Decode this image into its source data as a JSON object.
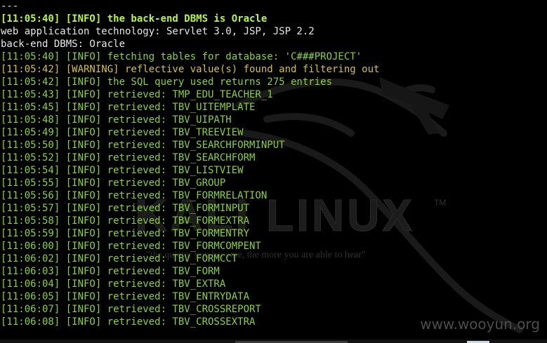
{
  "colors": {
    "background": "#000000",
    "normal_text": "#e8e8e8",
    "info_bold": "#b8f54a",
    "info": "#8ad42c",
    "warning": "#d6c32c"
  },
  "background": {
    "logo_text": "KALI LINUX",
    "logo_tm": "TM",
    "tagline": "\"the quieter you become, the more you are able to hear\"",
    "watermark": "www.wooyun.org"
  },
  "lines": [
    {
      "text": "---",
      "style": "white"
    },
    {
      "text": "[11:05:40] [INFO] the back-end DBMS is Oracle",
      "style": "bright"
    },
    {
      "text": "web application technology: Servlet 3.0, JSP, JSP 2.2",
      "style": "white"
    },
    {
      "text": "back-end DBMS: Oracle",
      "style": "white"
    },
    {
      "text": "[11:05:40] [INFO] fetching tables for database: 'C###PROJECT'",
      "style": "green"
    },
    {
      "text": "[11:05:42] [WARNING] reflective value(s) found and filtering out",
      "style": "yellow"
    },
    {
      "text": "[11:05:42] [INFO] the SQL query used returns 275 entries",
      "style": "green"
    },
    {
      "text": "[11:05:43] [INFO] retrieved: TMP_EDU_TEACHER_1",
      "style": "green"
    },
    {
      "text": "[11:05:45] [INFO] retrieved: TBV_UITEMPLATE",
      "style": "green"
    },
    {
      "text": "[11:05:48] [INFO] retrieved: TBV_UIPATH",
      "style": "green"
    },
    {
      "text": "[11:05:49] [INFO] retrieved: TBV_TREEVIEW",
      "style": "green"
    },
    {
      "text": "[11:05:50] [INFO] retrieved: TBV_SEARCHFORMINPUT",
      "style": "green"
    },
    {
      "text": "[11:05:52] [INFO] retrieved: TBV_SEARCHFORM",
      "style": "green"
    },
    {
      "text": "[11:05:54] [INFO] retrieved: TBV_LISTVIEW",
      "style": "green"
    },
    {
      "text": "[11:05:55] [INFO] retrieved: TBV_GROUP",
      "style": "green"
    },
    {
      "text": "[11:05:56] [INFO] retrieved: TBV_FORMRELATION",
      "style": "green"
    },
    {
      "text": "[11:05:57] [INFO] retrieved: TBV_FORMINPUT",
      "style": "green"
    },
    {
      "text": "[11:05:58] [INFO] retrieved: TBV_FORMEXTRA",
      "style": "green"
    },
    {
      "text": "[11:05:59] [INFO] retrieved: TBV_FORMENTRY",
      "style": "green"
    },
    {
      "text": "[11:06:00] [INFO] retrieved: TBV_FORMCOMPENT",
      "style": "green"
    },
    {
      "text": "[11:06:02] [INFO] retrieved: TBV_FORMCCT",
      "style": "green"
    },
    {
      "text": "[11:06:03] [INFO] retrieved: TBV_FORM",
      "style": "green"
    },
    {
      "text": "[11:06:04] [INFO] retrieved: TBV_EXTRA",
      "style": "green"
    },
    {
      "text": "[11:06:05] [INFO] retrieved: TBV_ENTRYDATA",
      "style": "green"
    },
    {
      "text": "[11:06:07] [INFO] retrieved: TBV_CROSSREPORT",
      "style": "green"
    },
    {
      "text": "[11:06:08] [INFO] retrieved: TBV_CROSSEXTRA",
      "style": "green"
    }
  ]
}
